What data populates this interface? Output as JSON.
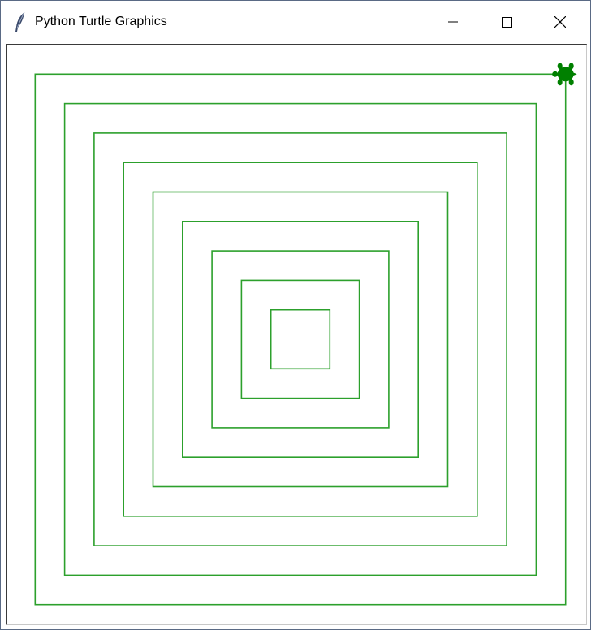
{
  "window": {
    "title": "Python Turtle Graphics",
    "title_icon": "feather-icon",
    "controls": {
      "minimize_icon": "minimize-icon",
      "maximize_icon": "maximize-icon",
      "close_icon": "close-icon"
    }
  },
  "canvas": {
    "background": "#ffffff",
    "pen_color": "#2ca02c",
    "turtle_color": "#008000",
    "spiral_squares": 9,
    "turtle_icon": "turtle-icon"
  }
}
